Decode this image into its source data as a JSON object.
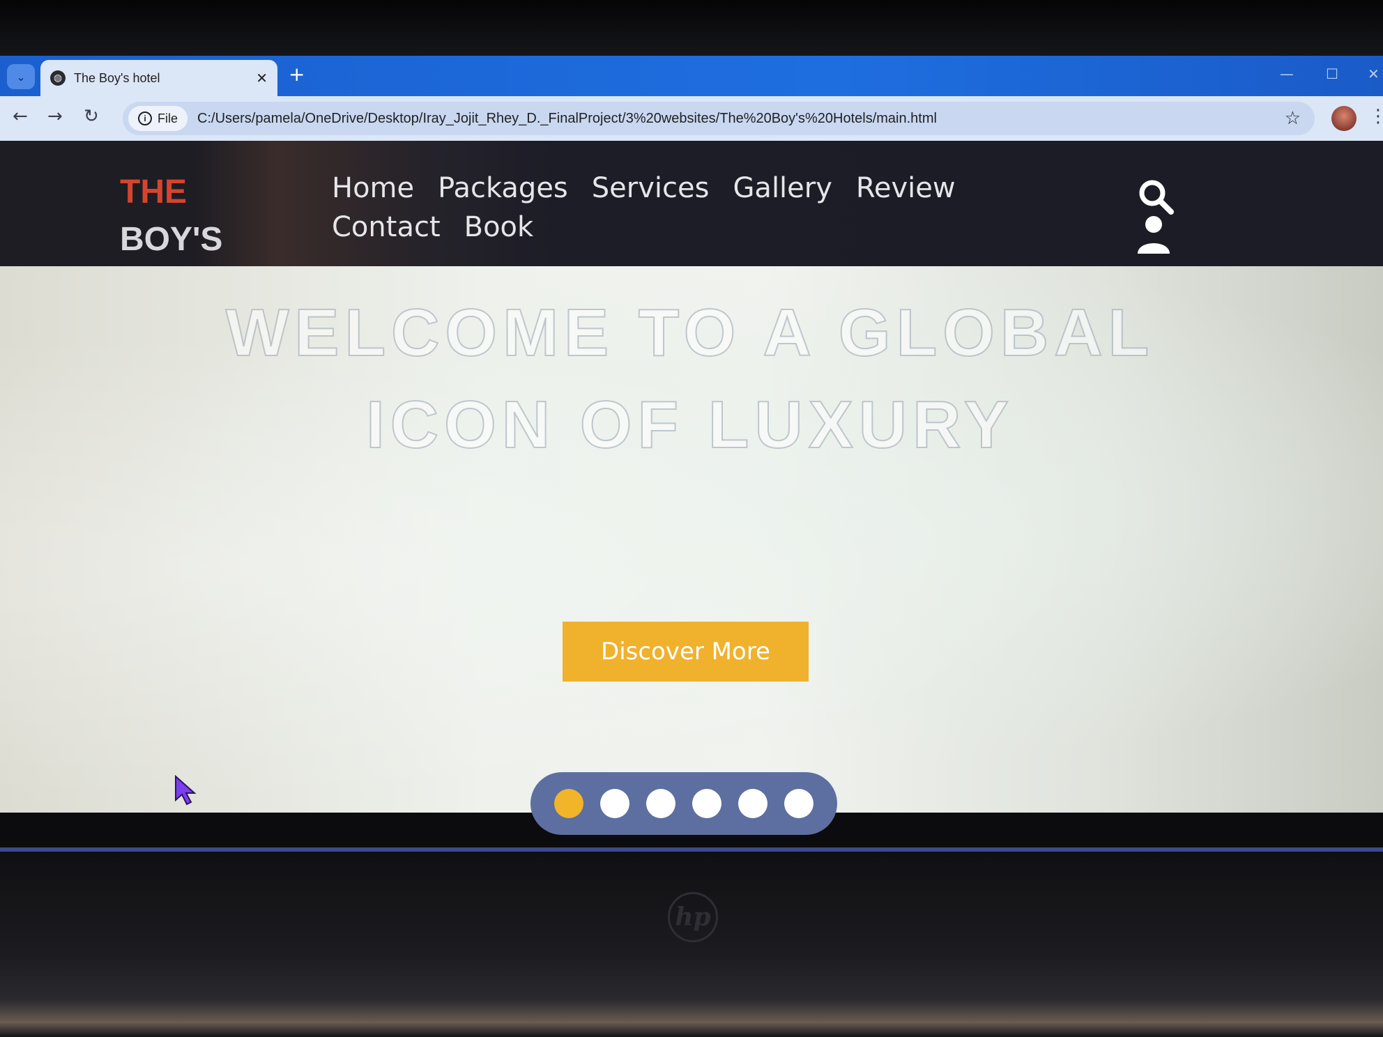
{
  "browser": {
    "tab_title": "The Boy's hotel",
    "tab_close": "✕",
    "new_tab": "+",
    "site_chip_label": "File",
    "url": "C:/Users/pamela/OneDrive/Desktop/Iray_Jojit_Rhey_D._FinalProject/3%20websites/The%20Boy's%20Hotels/main.html"
  },
  "header": {
    "logo_line1": "THE",
    "logo_line2": "BOY'S",
    "nav": [
      "Home",
      "Packages",
      "Services",
      "Gallery",
      "Review",
      "Contact",
      "Book"
    ]
  },
  "hero": {
    "title": "WELCOME TO A GLOBAL ICON OF LUXURY",
    "cta_label": "Discover More",
    "slider": {
      "count": 6,
      "active_index": 0
    }
  },
  "colors": {
    "logo_accent": "#d6442d",
    "cta": "#f0b12d",
    "active_dot": "#f2b428",
    "dots_bar": "#5d6fa0",
    "browser_accent": "#1e6ee0"
  },
  "icons": [
    "search-icon",
    "user-icon",
    "star-icon",
    "info-icon",
    "back-arrow-icon",
    "forward-arrow-icon",
    "reload-icon",
    "globe-icon"
  ]
}
